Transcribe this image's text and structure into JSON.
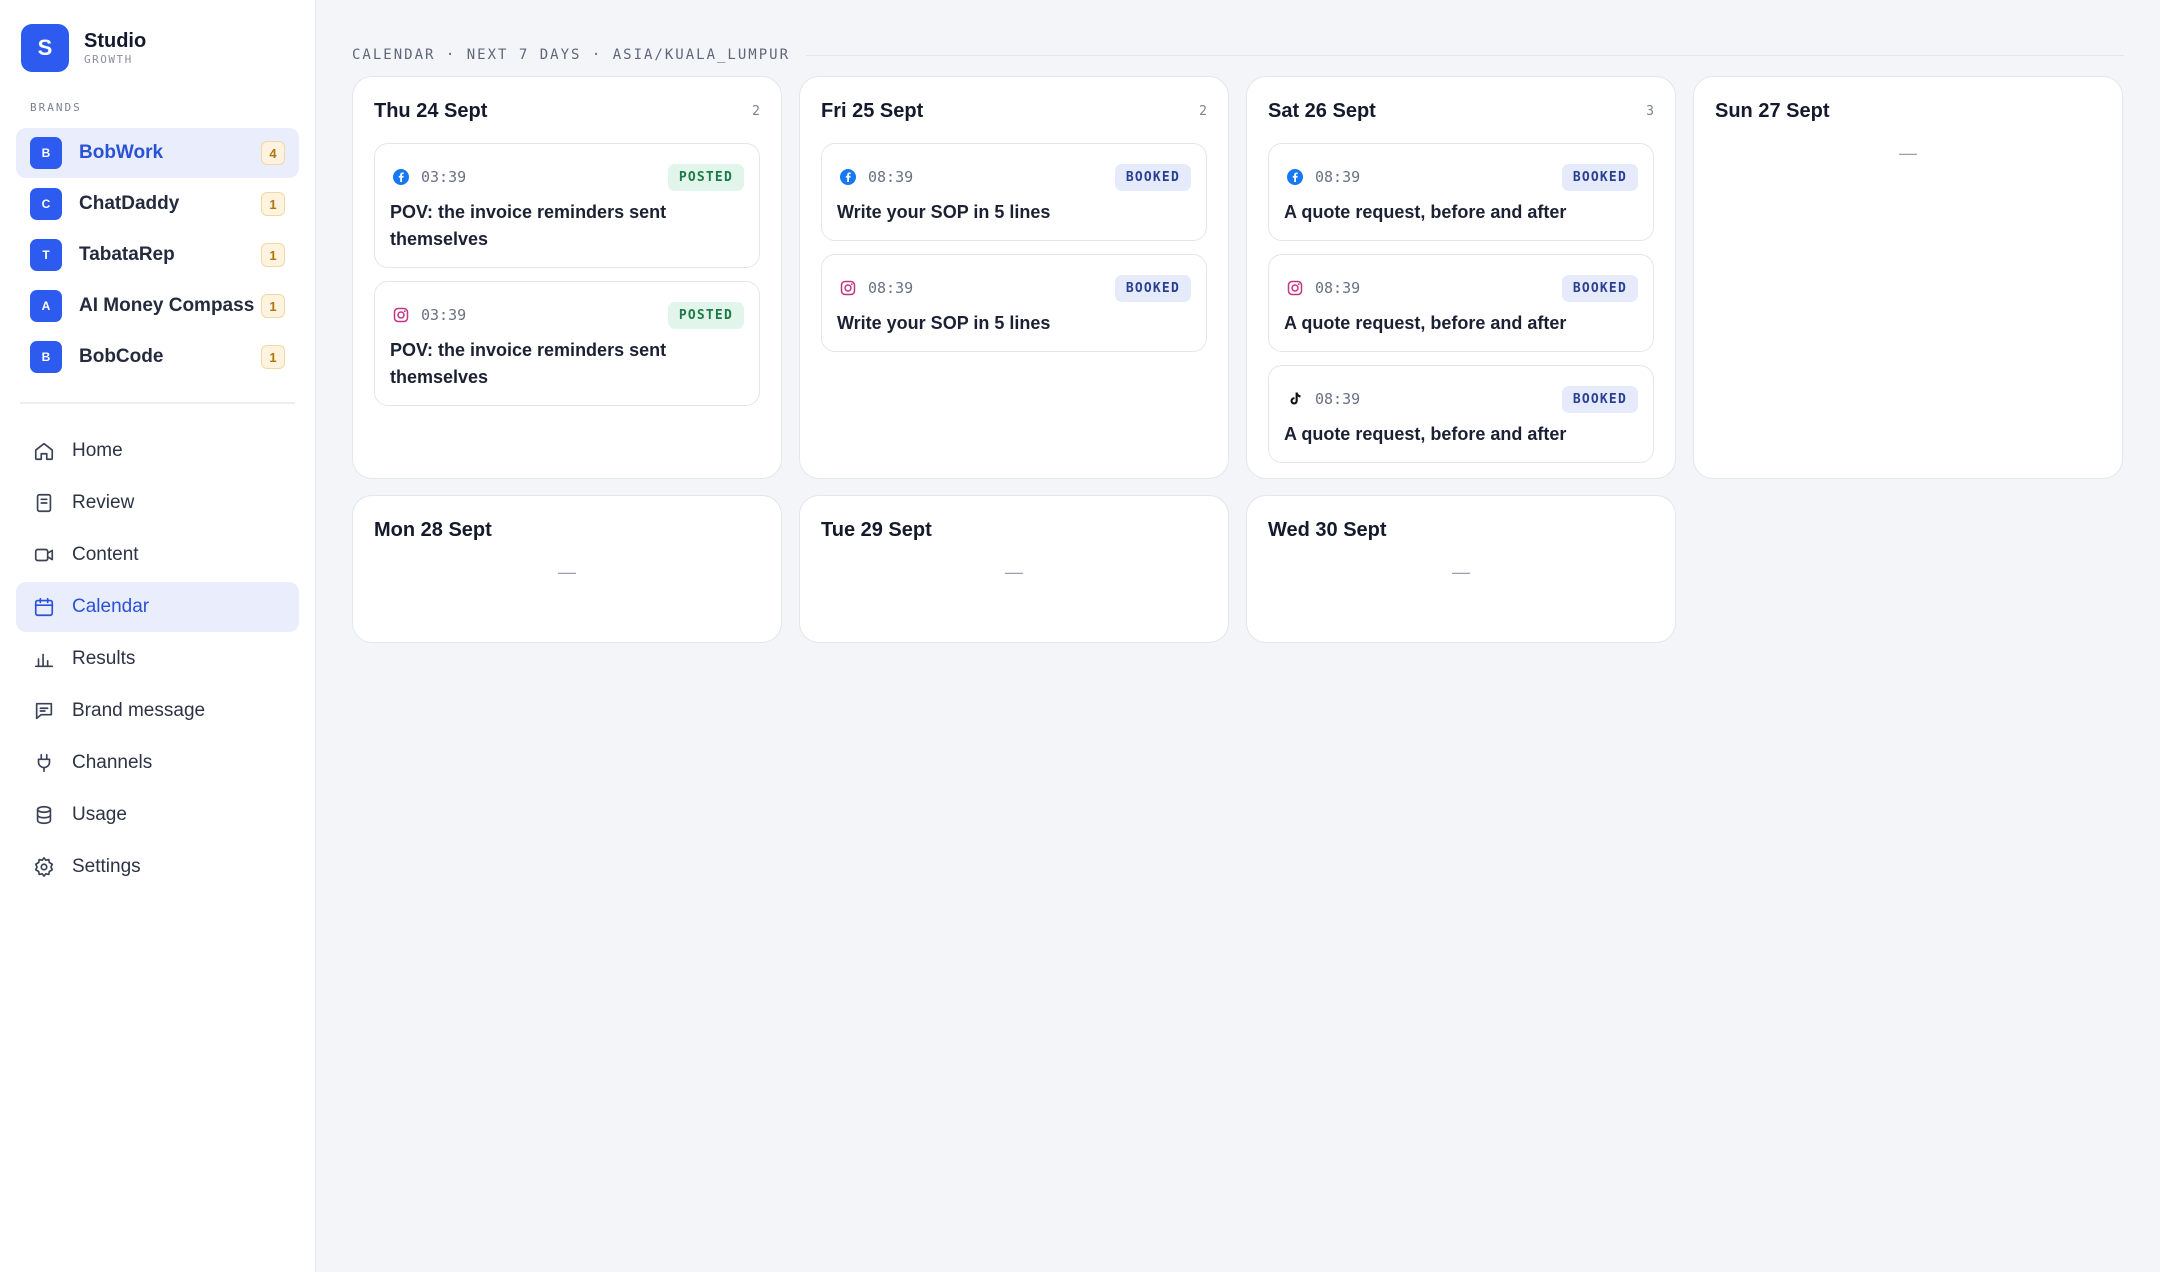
{
  "app": {
    "logo_letter": "S",
    "title": "Studio",
    "subtitle": "GROWTH"
  },
  "sidebar": {
    "brands_label": "BRANDS",
    "brands": [
      {
        "initial": "B",
        "name": "BobWork",
        "count": "4",
        "active": true
      },
      {
        "initial": "C",
        "name": "ChatDaddy",
        "count": "1",
        "active": false
      },
      {
        "initial": "T",
        "name": "TabataRep",
        "count": "1",
        "active": false
      },
      {
        "initial": "A",
        "name": "AI Money Compass",
        "count": "1",
        "active": false
      },
      {
        "initial": "B",
        "name": "BobCode",
        "count": "1",
        "active": false
      }
    ],
    "nav": [
      {
        "label": "Home",
        "icon": "home-icon",
        "active": false
      },
      {
        "label": "Review",
        "icon": "document-icon",
        "active": false
      },
      {
        "label": "Content",
        "icon": "video-icon",
        "active": false
      },
      {
        "label": "Calendar",
        "icon": "calendar-icon",
        "active": true
      },
      {
        "label": "Results",
        "icon": "bar-chart-icon",
        "active": false
      },
      {
        "label": "Brand message",
        "icon": "message-icon",
        "active": false
      },
      {
        "label": "Channels",
        "icon": "plug-icon",
        "active": false
      },
      {
        "label": "Usage",
        "icon": "database-icon",
        "active": false
      },
      {
        "label": "Settings",
        "icon": "gear-icon",
        "active": false
      }
    ]
  },
  "calendar": {
    "header": "CALENDAR · NEXT 7 DAYS · ASIA/KUALA_LUMPUR",
    "empty_marker": "—",
    "days": [
      {
        "title": "Thu 24 Sept",
        "count": "2",
        "posts": [
          {
            "platform": "facebook",
            "time": "03:39",
            "status": "POSTED",
            "title": "POV: the invoice reminders sent themselves"
          },
          {
            "platform": "instagram",
            "time": "03:39",
            "status": "POSTED",
            "title": "POV: the invoice reminders sent themselves"
          }
        ]
      },
      {
        "title": "Fri 25 Sept",
        "count": "2",
        "posts": [
          {
            "platform": "facebook",
            "time": "08:39",
            "status": "BOOKED",
            "title": "Write your SOP in 5 lines"
          },
          {
            "platform": "instagram",
            "time": "08:39",
            "status": "BOOKED",
            "title": "Write your SOP in 5 lines"
          }
        ]
      },
      {
        "title": "Sat 26 Sept",
        "count": "3",
        "posts": [
          {
            "platform": "facebook",
            "time": "08:39",
            "status": "BOOKED",
            "title": "A quote request, before and after"
          },
          {
            "platform": "instagram",
            "time": "08:39",
            "status": "BOOKED",
            "title": "A quote request, before and after"
          },
          {
            "platform": "tiktok",
            "time": "08:39",
            "status": "BOOKED",
            "title": "A quote request, before and after"
          }
        ]
      },
      {
        "title": "Sun 27 Sept",
        "count": "",
        "posts": []
      },
      {
        "title": "Mon 28 Sept",
        "count": "",
        "posts": []
      },
      {
        "title": "Tue 29 Sept",
        "count": "",
        "posts": []
      },
      {
        "title": "Wed 30 Sept",
        "count": "",
        "posts": []
      }
    ]
  },
  "colors": {
    "accent": "#2d5bf0",
    "posted_badge": "#e2f5ea",
    "booked_badge": "#e6ebfb",
    "facebook": "#1877f2",
    "instagram": "#c13584",
    "tiktok": "#111111"
  }
}
